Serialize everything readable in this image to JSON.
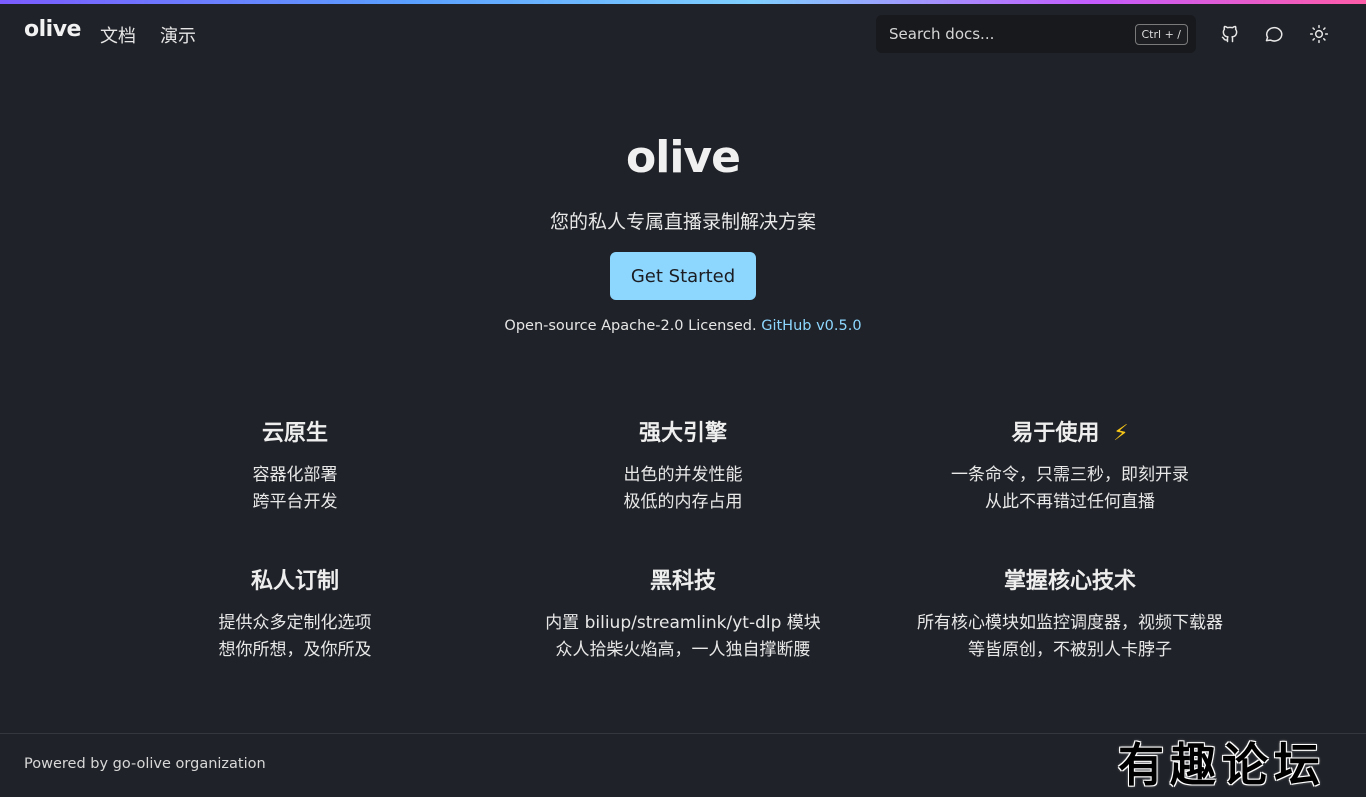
{
  "nav": {
    "logo": "olive",
    "links": [
      "文档",
      "演示"
    ],
    "search_placeholder": "Search docs...",
    "search_shortcut": "Ctrl + /",
    "icons": [
      "github-icon",
      "chat-icon",
      "sun-icon"
    ]
  },
  "hero": {
    "title": "olive",
    "subtitle": "您的私人专属直播录制解决方案",
    "cta": "Get Started",
    "license_text": "Open-source Apache-2.0 Licensed.",
    "github_link": "GitHub v0.5.0"
  },
  "features": [
    {
      "title": "云原生",
      "lines": [
        "容器化部署",
        "跨平台开发"
      ]
    },
    {
      "title": "强大引擎",
      "lines": [
        "出色的并发性能",
        "极低的内存占用"
      ]
    },
    {
      "title": "易于使用",
      "emoji": "⚡",
      "lines": [
        "一条命令，只需三秒，即刻开录",
        "从此不再错过任何直播"
      ]
    },
    {
      "title": "私人订制",
      "lines": [
        "提供众多定制化选项",
        "想你所想，及你所及"
      ]
    },
    {
      "title": "黑科技",
      "lines": [
        "内置 biliup/streamlink/yt-dlp 模块",
        "众人拾柴火焰高，一人独自撑断腰"
      ]
    },
    {
      "title": "掌握核心技术",
      "lines": [
        "所有核心模块如监控调度器，视频下载器",
        "等皆原创，不被别人卡脖子"
      ]
    }
  ],
  "footer": {
    "text": "Powered by go-olive organization"
  },
  "watermark": "有趣论坛",
  "colors": {
    "background": "#1f2228",
    "accent": "#8dd7ff",
    "search_bg": "#17191d"
  }
}
